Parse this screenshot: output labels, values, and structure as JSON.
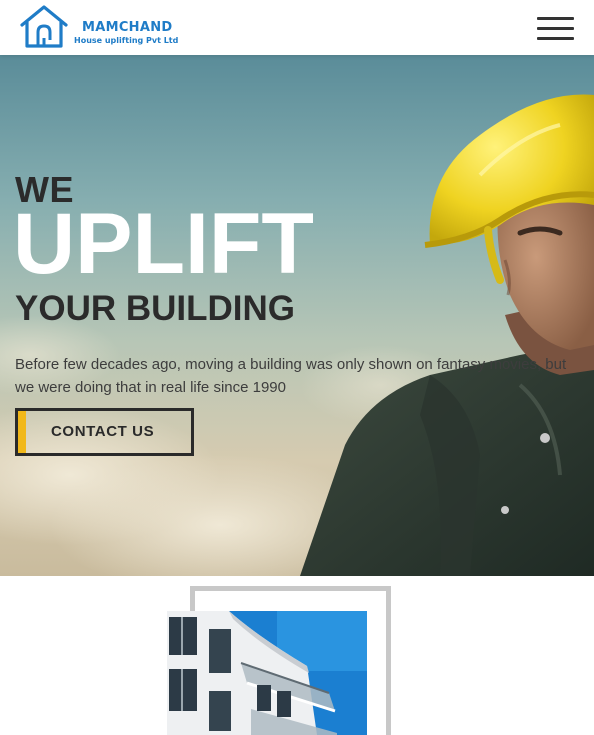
{
  "header": {
    "brand_name": "MAMCHAND",
    "brand_tagline": "House uplifting Pvt Ltd",
    "logo_icon": "house-logo-icon",
    "menu_icon": "hamburger-menu-icon"
  },
  "hero": {
    "line1": "WE",
    "line2": "UPLIFT",
    "line3": "YOUR BUILDING",
    "description": "Before few decades ago, moving a building was only shown on fantasy movies, but we were doing that in real life since 1990",
    "cta_label": "CONTACT US",
    "image_subject": "worker-in-yellow-hardhat"
  },
  "colors": {
    "brand_blue": "#1f7cc7",
    "accent_yellow": "#f1b81a",
    "dark_text": "#2b2b2b"
  },
  "gallery": {
    "image_subject": "modern-apartment-building"
  }
}
